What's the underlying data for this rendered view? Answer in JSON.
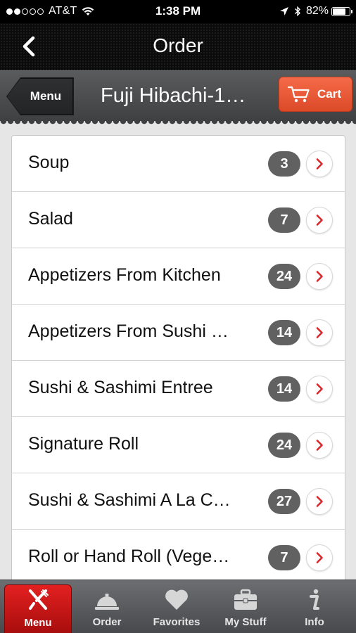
{
  "status_bar": {
    "carrier": "AT&T",
    "time": "1:38 PM",
    "battery": "82%",
    "battery_level": 0.82
  },
  "nav": {
    "title": "Order",
    "back_icon": "chevron-left-icon"
  },
  "sub_header": {
    "back_label": "Menu",
    "restaurant_name": "Fuji Hibachi-1…",
    "cart_label": "Cart"
  },
  "menu_categories": [
    {
      "label": "Soup",
      "count": "3"
    },
    {
      "label": "Salad",
      "count": "7"
    },
    {
      "label": "Appetizers From Kitchen",
      "count": "24"
    },
    {
      "label": "Appetizers From Sushi …",
      "count": "14"
    },
    {
      "label": "Sushi & Sashimi Entree",
      "count": "14"
    },
    {
      "label": "Signature Roll",
      "count": "24"
    },
    {
      "label": "Sushi & Sashimi A La C…",
      "count": "27"
    },
    {
      "label": "Roll or Hand Roll (Vege…",
      "count": "7"
    }
  ],
  "tabs": [
    {
      "label": "Menu",
      "icon": "fork-knife-icon",
      "active": true
    },
    {
      "label": "Order",
      "icon": "service-bell-icon",
      "active": false
    },
    {
      "label": "Favorites",
      "icon": "heart-icon",
      "active": false
    },
    {
      "label": "My Stuff",
      "icon": "briefcase-icon",
      "active": false
    },
    {
      "label": "Info",
      "icon": "info-icon",
      "active": false
    }
  ],
  "colors": {
    "cart_accent": "#e8573a",
    "active_tab": "#cc1414",
    "chevron": "#d9262a",
    "badge": "#616161"
  }
}
